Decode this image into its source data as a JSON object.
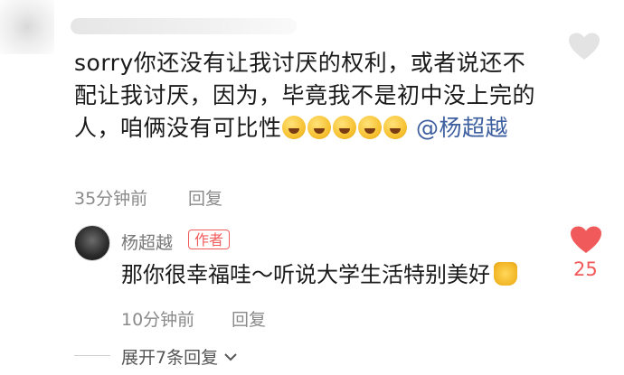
{
  "comment": {
    "text_lines": [
      "sorry你还没有让我讨厌的权利，或者说还不",
      "配让我讨厌，因为，毕竟我不是初中没上完的",
      "人，咱俩没有可比性"
    ],
    "mention": "@杨超越",
    "time": "35分钟前",
    "reply_label": "回复"
  },
  "reply": {
    "author_name": "杨超越",
    "author_badge": "作者",
    "text": "那你很幸福哇～听说大学生活特别美好",
    "time": "10分钟前",
    "reply_label": "回复",
    "like_count": "25"
  },
  "expand_replies_label": "展开7条回复",
  "colors": {
    "like_active": "#f05a5a",
    "mention": "#3d5fa0",
    "badge": "#f25b5b"
  }
}
